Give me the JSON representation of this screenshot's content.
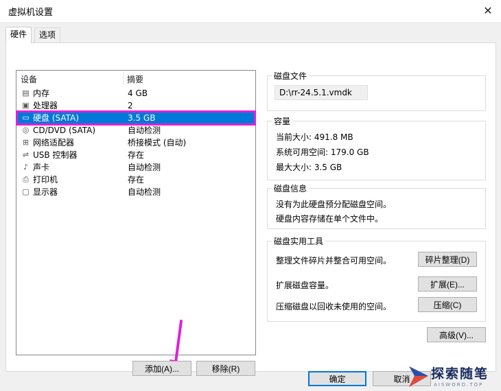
{
  "window": {
    "title": "虚拟机设置"
  },
  "tabs": [
    {
      "label": "硬件",
      "active": true
    },
    {
      "label": "选项",
      "active": false
    }
  ],
  "device_list": {
    "columns": [
      "设备",
      "摘要"
    ],
    "rows": [
      {
        "icon": "memory-icon",
        "name": "内存",
        "summary": "4 GB"
      },
      {
        "icon": "cpu-icon",
        "name": "处理器",
        "summary": "2"
      },
      {
        "icon": "hard-disk-icon",
        "name": "硬盘 (SATA)",
        "summary": "3.5 GB",
        "selected": true
      },
      {
        "icon": "cd-dvd-icon",
        "name": "CD/DVD (SATA)",
        "summary": "自动检测"
      },
      {
        "icon": "network-icon",
        "name": "网络适配器",
        "summary": "桥接模式 (自动)"
      },
      {
        "icon": "usb-icon",
        "name": "USB 控制器",
        "summary": "存在"
      },
      {
        "icon": "sound-icon",
        "name": "声卡",
        "summary": "自动检测"
      },
      {
        "icon": "printer-icon",
        "name": "打印机",
        "summary": "存在"
      },
      {
        "icon": "display-icon",
        "name": "显示器",
        "summary": "自动检测"
      }
    ],
    "add_button": "添加(A)...",
    "remove_button": "移除(R)"
  },
  "disk_file": {
    "title": "磁盘文件",
    "path": "D:\\rr-24.5.1.vmdk"
  },
  "capacity": {
    "title": "容量",
    "current_size": "当前大小: 491.8 MB",
    "free_space": "系统可用空间: 179.0 GB",
    "max_size": "最大大小: 3.5 GB"
  },
  "disk_info": {
    "title": "磁盘信息",
    "line1": "没有为此硬盘预分配磁盘空间。",
    "line2": "硬盘内容存储在单个文件中。"
  },
  "disk_tools": {
    "title": "磁盘实用工具",
    "defrag_text": "整理文件碎片并整合可用空间。",
    "defrag_button": "碎片整理(D)",
    "expand_text": "扩展磁盘容量。",
    "expand_button": "扩展(E)...",
    "compact_text": "压缩磁盘以回收未使用的空间。",
    "compact_button": "压缩(C)"
  },
  "advanced_button": "高级(V)...",
  "footer": {
    "ok_button": "确定",
    "cancel_button": "取消"
  },
  "watermark": {
    "text": "探索随笔",
    "sub": "AISWORD.TOP"
  },
  "colors": {
    "selection": "#0078d7",
    "highlight_box": "#e020d8",
    "arrow": "#e020d8"
  }
}
